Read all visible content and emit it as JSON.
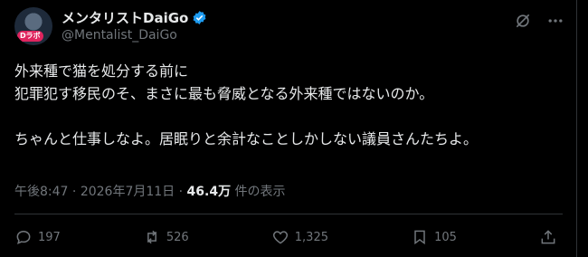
{
  "author": {
    "display_name": "メンタリストDaiGo",
    "handle": "@Mentalist_DaiGo",
    "avatar_badge": "Dラボ"
  },
  "tweet": {
    "text": "外来種で猫を処分する前に\n犯罪犯す移民のそ、まさに最も脅威となる外来種ではないのか。\n\nちゃんと仕事しなよ。居眠りと余計なことしかしない議員さんたちよ。",
    "time": "午後8:47",
    "date": "2026年7月11日",
    "views_count": "46.4万",
    "views_label": "件の表示"
  },
  "metrics": {
    "replies": "197",
    "reposts": "526",
    "likes": "1,325",
    "bookmarks": "105"
  },
  "colors": {
    "background": "#000000",
    "text": "#e7e9ea",
    "muted": "#71767b",
    "verified": "#1d9bf0"
  }
}
